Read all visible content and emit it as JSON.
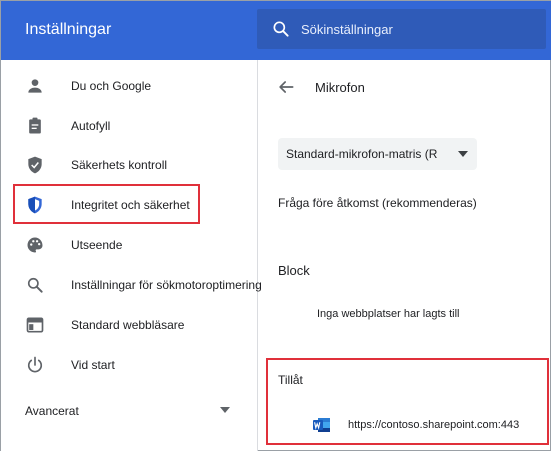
{
  "header": {
    "title": "Inställningar",
    "search_placeholder": "Sökinställningar",
    "bg_color": "#3367d6"
  },
  "sidebar": {
    "items": [
      {
        "label": "Du och Google",
        "icon": "person-icon"
      },
      {
        "label": "Autofyll",
        "icon": "clipboard-icon"
      },
      {
        "label": "Säkerhets kontroll",
        "icon": "shield-check-icon"
      },
      {
        "label": "Integritet och säkerhet",
        "icon": "shield-privacy-icon",
        "active": true
      },
      {
        "label": "Utseende",
        "icon": "palette-icon"
      },
      {
        "label": "Inställningar för sökmotoroptimering",
        "icon": "search-icon"
      },
      {
        "label": "Standard webbläsare",
        "icon": "browser-icon"
      },
      {
        "label": "Vid start",
        "icon": "power-icon"
      }
    ],
    "advanced_label": "Avancerat"
  },
  "main": {
    "title": "Mikrofon",
    "device_select": "Standard-mikrofon-matris (R",
    "ask_label": "Fråga före åtkomst (rekommenderas)",
    "block_heading": "Block",
    "block_empty": "Inga webbplatser har lagts till",
    "allow_heading": "Tillåt",
    "allowed_sites": [
      {
        "url": "https://contoso.sharepoint.com:443",
        "icon": "word-icon"
      }
    ]
  },
  "colors": {
    "accent": "#3367d6",
    "highlight": "#e0303a",
    "icon_gray": "#5f6368",
    "word_blue": "#2b579a"
  }
}
